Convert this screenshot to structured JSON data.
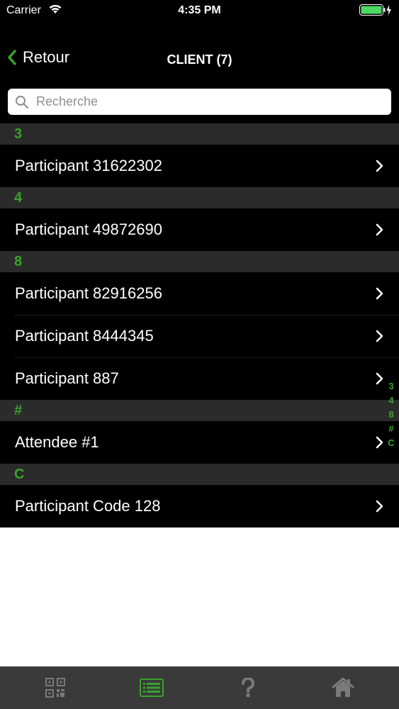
{
  "status_bar": {
    "carrier": "Carrier",
    "time": "4:35 PM"
  },
  "nav": {
    "back_label": "Retour",
    "title": "CLIENT (7)"
  },
  "search": {
    "placeholder": "Recherche",
    "value": ""
  },
  "sections": [
    {
      "header": "3",
      "items": [
        "Participant 31622302"
      ]
    },
    {
      "header": "4",
      "items": [
        "Participant 49872690"
      ]
    },
    {
      "header": "8",
      "items": [
        "Participant 82916256",
        "Participant 8444345",
        "Participant 887"
      ]
    },
    {
      "header": "#",
      "items": [
        "Attendee #1"
      ]
    },
    {
      "header": "C",
      "items": [
        "Participant Code 128"
      ]
    }
  ],
  "index": [
    "3",
    "4",
    "8",
    "#",
    "C"
  ],
  "tabs": [
    {
      "icon": "qr-code-icon",
      "active": false
    },
    {
      "icon": "list-icon",
      "active": true
    },
    {
      "icon": "help-icon",
      "active": false
    },
    {
      "icon": "home-icon",
      "active": false
    }
  ],
  "colors": {
    "accent": "#3aa32c",
    "background": "#000000",
    "section_bg": "#2b2b2b",
    "tab_bar_bg": "#3a3a3a",
    "inactive_icon": "#7a7a7a",
    "battery": "#4cd964"
  }
}
